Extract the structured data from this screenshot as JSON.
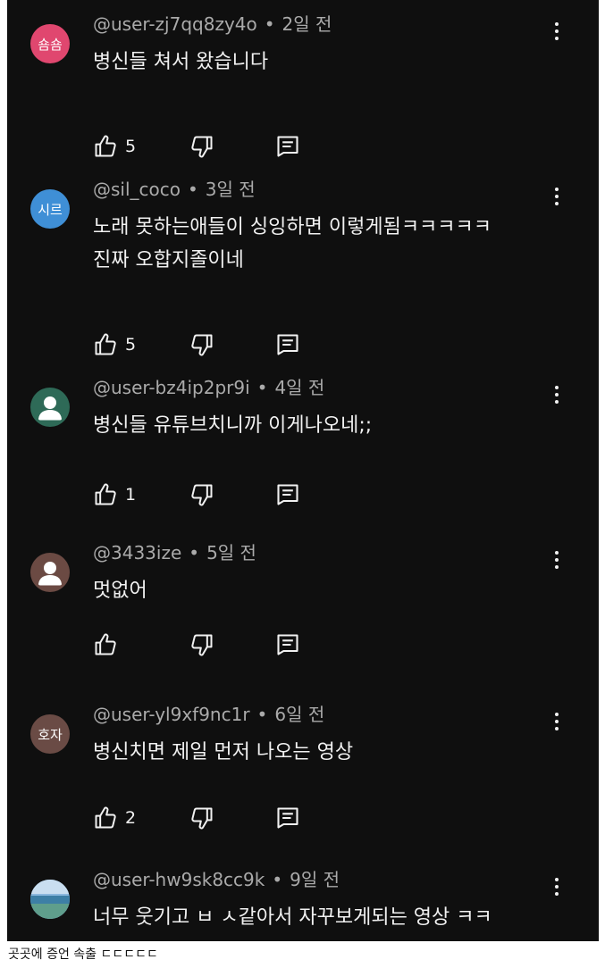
{
  "comments": [
    {
      "avatar_text": "숌숌",
      "avatar_color": "#e0476f",
      "handle": "@user-zj7qq8zy4o",
      "time": "2일 전",
      "lines": [
        "병신들 쳐서 왔습니다"
      ],
      "likes": "5"
    },
    {
      "avatar_text": "시르",
      "avatar_color": "#3f8fd6",
      "handle": "@sil_coco",
      "time": "3일 전",
      "lines": [
        "노래 못하는애들이 싱잉하면 이렇게됨ㅋㅋㅋㅋㅋ",
        "진짜 오합지졸이네"
      ],
      "likes": "5"
    },
    {
      "avatar_text": "",
      "avatar_color": "#2e6a57",
      "avatar_icon": "person-icon",
      "handle": "@user-bz4ip2pr9i",
      "time": "4일 전",
      "lines": [
        "병신들 유튜브치니까 이게나오네;;"
      ],
      "likes": "1"
    },
    {
      "avatar_text": "",
      "avatar_color": "#6b4a43",
      "avatar_icon": "person-icon",
      "handle": "@3433ize",
      "time": "5일 전",
      "lines": [
        "멋없어"
      ],
      "likes": ""
    },
    {
      "avatar_text": "호자",
      "avatar_color": "#6a4b45",
      "handle": "@user-yl9xf9nc1r",
      "time": "6일 전",
      "lines": [
        "병신치면 제일 먼저 나오는 영상"
      ],
      "likes": "2"
    },
    {
      "avatar_text": "",
      "avatar_color": "#5d8fb5",
      "avatar_icon": "landscape-photo",
      "handle": "@user-hw9sk8cc9k",
      "time": "9일 전",
      "lines": [
        "너무 웃기고 ㅂ ㅅ같아서 자꾸보게되는 영상 ㅋㅋ"
      ],
      "likes": ""
    }
  ],
  "caption": "곳곳에 증언 속출 ㄷㄷㄷㄷㄷ",
  "colors": {
    "background": "#0f0f0f",
    "text": "#f1f1f1",
    "meta": "#aaaaaa"
  }
}
